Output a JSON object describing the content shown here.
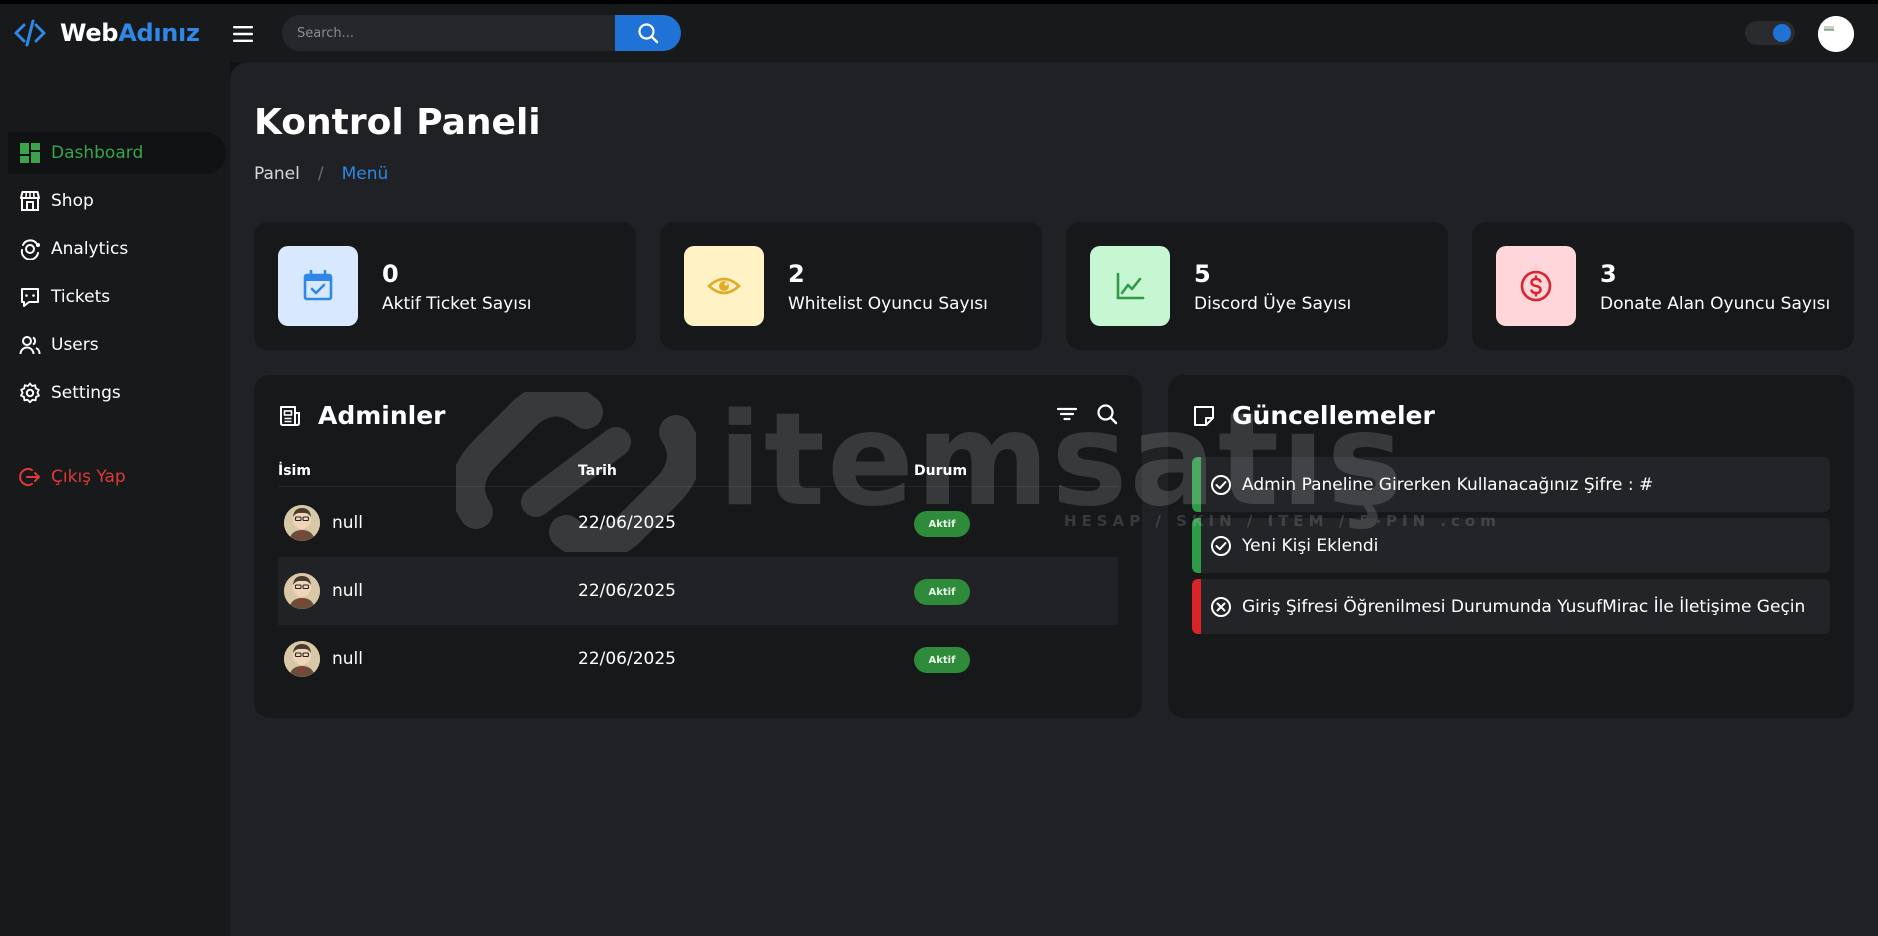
{
  "brand": {
    "part1": "Web",
    "part2": "Adınız"
  },
  "search": {
    "placeholder": "Search..."
  },
  "sidebar": {
    "items": [
      {
        "label": "Dashboard",
        "icon": "dashboard-icon",
        "active": true
      },
      {
        "label": "Shop",
        "icon": "shop-icon"
      },
      {
        "label": "Analytics",
        "icon": "analytics-icon"
      },
      {
        "label": "Tickets",
        "icon": "tickets-icon"
      },
      {
        "label": "Users",
        "icon": "users-icon"
      },
      {
        "label": "Settings",
        "icon": "gear-icon"
      }
    ],
    "logout": {
      "label": "Çıkış Yap",
      "icon": "logout-icon"
    }
  },
  "page": {
    "title": "Kontrol Paneli",
    "breadcrumb": [
      "Panel",
      "/",
      "Menü"
    ]
  },
  "stats": [
    {
      "value": "0",
      "label": "Aktif Ticket Sayısı",
      "icon": "calendar-check-icon",
      "color": "#2f87e6",
      "bg": "#d7e8ff"
    },
    {
      "value": "2",
      "label": "Whitelist Oyuncu Sayısı",
      "icon": "eye-icon",
      "color": "#e3ab27",
      "bg": "#fff3c6"
    },
    {
      "value": "5",
      "label": "Discord Üye Sayısı",
      "icon": "chart-line-icon",
      "color": "#2e9b47",
      "bg": "#c7f6d3"
    },
    {
      "value": "3",
      "label": "Donate Alan Oyuncu Sayısı",
      "icon": "dollar-circle-icon",
      "color": "#d9252a",
      "bg": "#ffd6da"
    }
  ],
  "admins": {
    "title": "Adminler",
    "columns": [
      "İsim",
      "Tarih",
      "Durum"
    ],
    "rows": [
      {
        "name": "null",
        "date": "22/06/2025",
        "status": "Aktif"
      },
      {
        "name": "null",
        "date": "22/06/2025",
        "status": "Aktif"
      },
      {
        "name": "null",
        "date": "22/06/2025",
        "status": "Aktif"
      }
    ]
  },
  "updates": {
    "title": "Güncellemeler",
    "items": [
      {
        "text": "Admin Paneline Girerken Kullanacağınız Şifre : #",
        "type": "success",
        "icon": "check-circle-icon",
        "color": "#2e9b47"
      },
      {
        "text": "Yeni Kişi Eklendi",
        "type": "success",
        "icon": "check-circle-icon",
        "color": "#2e9b47"
      },
      {
        "text": "Giriş Şifresi Öğrenilmesi Durumunda YusufMirac İle İletişime Geçin",
        "type": "error",
        "icon": "x-circle-icon",
        "color": "#d9252a"
      }
    ]
  },
  "watermark": {
    "text": "itemsatış",
    "sub": "HESAP / SKIN / ITEM / E-PIN .com"
  },
  "colors": {
    "accent": "#2f87e6",
    "active_nav": "#3aa34c",
    "danger": "#e0393a"
  }
}
